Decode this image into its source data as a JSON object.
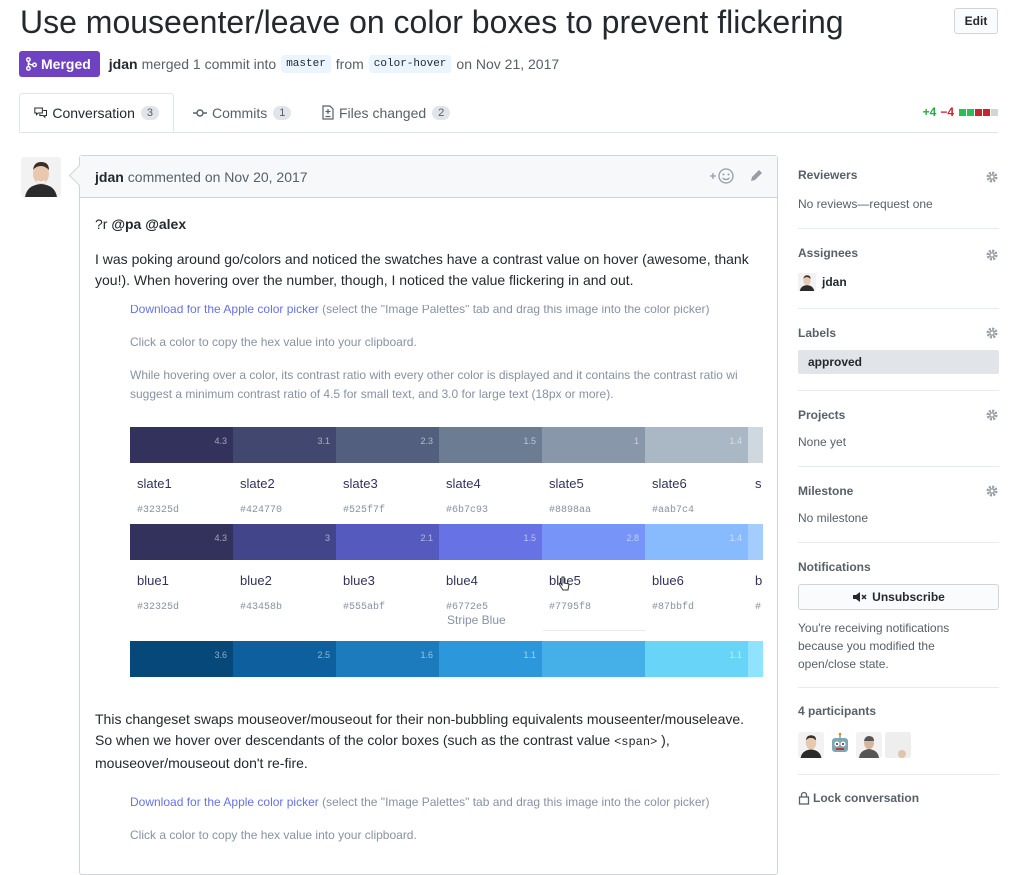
{
  "pr": {
    "title": "Use mouseenter/leave on color boxes to prevent flickering",
    "edit_label": "Edit",
    "status": "Merged",
    "author": "jdan",
    "merge_text": "merged 1 commit into",
    "base_branch": "master",
    "from_text": "from",
    "head_branch": "color-hover",
    "date_text": "on Nov 21, 2017"
  },
  "tabs": [
    {
      "label": "Conversation",
      "count": "3"
    },
    {
      "label": "Commits",
      "count": "1"
    },
    {
      "label": "Files changed",
      "count": "2"
    }
  ],
  "diffstat": {
    "additions": "+4",
    "deletions": "−4"
  },
  "comment": {
    "author": "jdan",
    "action": "commented on Nov 20, 2017",
    "mention_prefix": "?r",
    "mentions": "@pa @alex",
    "para1": "I was poking around go/colors and noticed the swatches have a contrast value on hover (awesome, thank you!). When hovering over the number, though, I noticed the value flickering in and out.",
    "para2a": "This changeset swaps mouseover/mouseout for their non-bubbling equivalents mouseenter/mouseleave. So when we hover over descendants of the color boxes (such as the contrast value ",
    "para2code": "<span>",
    "para2b": " ), mouseover/mouseout don't re-fire."
  },
  "screenshot": {
    "download_link": "Download for the Apple color picker",
    "download_rest": " (select the \"Image Palettes\" tab and drag this image into the color picker)",
    "click_text": "Click a color to copy the hex value into your clipboard.",
    "hover_text1": "While hovering over a color, its contrast ratio with every other color is displayed and it contains the contrast ratio wi",
    "hover_text2": "suggest a minimum contrast ratio of 4.5 for small text, and 3.0 for large text (18px or more).",
    "slate": [
      {
        "name": "slate1",
        "hex": "#32325d",
        "color": "#32325d",
        "ratio": "4.3"
      },
      {
        "name": "slate2",
        "hex": "#424770",
        "color": "#424770",
        "ratio": "3.1"
      },
      {
        "name": "slate3",
        "hex": "#525f7f",
        "color": "#525f7f",
        "ratio": "2.3"
      },
      {
        "name": "slate4",
        "hex": "#6b7c93",
        "color": "#6b7c93",
        "ratio": "1.5"
      },
      {
        "name": "slate5",
        "hex": "#8898aa",
        "color": "#8898aa",
        "ratio": "1"
      },
      {
        "name": "slate6",
        "hex": "#aab7c4",
        "color": "#aab7c4",
        "ratio": "1.4"
      },
      {
        "name": "s",
        "hex": "",
        "color": "#cfd7df",
        "ratio": ""
      }
    ],
    "blue": [
      {
        "name": "blue1",
        "hex": "#32325d",
        "color": "#32325d",
        "ratio": "4.3"
      },
      {
        "name": "blue2",
        "hex": "#43458b",
        "color": "#43458b",
        "ratio": "3"
      },
      {
        "name": "blue3",
        "hex": "#555abf",
        "color": "#555abf",
        "ratio": "2.1"
      },
      {
        "name": "blue4",
        "hex": "#6772e5",
        "color": "#6772e5",
        "ratio": "1.5"
      },
      {
        "name": "blue5",
        "hex": "#7795f8",
        "color": "#7795f8",
        "ratio": "2.8"
      },
      {
        "name": "blue6",
        "hex": "#87bbfd",
        "color": "#87bbfd",
        "ratio": "1.4"
      },
      {
        "name": "b",
        "hex": "#",
        "color": "#a4cdfe",
        "ratio": ""
      }
    ],
    "stripe_blue": "Stripe Blue",
    "cyan": [
      {
        "color": "#064879",
        "ratio": "3.6"
      },
      {
        "color": "#0d5f9e",
        "ratio": "2.5"
      },
      {
        "color": "#1c7bbd",
        "ratio": "1.6"
      },
      {
        "color": "#2d97db",
        "ratio": "1.1"
      },
      {
        "color": "#45b0e8",
        "ratio": ""
      },
      {
        "color": "#68d4f8",
        "ratio": "1.1"
      },
      {
        "color": "#8fe3fc",
        "ratio": ""
      }
    ]
  },
  "sidebar": {
    "reviewers_h": "Reviewers",
    "reviewers_v": "No reviews—request one",
    "assignees_h": "Assignees",
    "assignee": "jdan",
    "labels_h": "Labels",
    "label": "approved",
    "projects_h": "Projects",
    "projects_v": "None yet",
    "milestone_h": "Milestone",
    "milestone_v": "No milestone",
    "notifications_h": "Notifications",
    "unsubscribe": "Unsubscribe",
    "notif_reason": "You're receiving notifications because you modified the open/close state.",
    "participants_h": "4 participants",
    "lock": "Lock conversation"
  }
}
